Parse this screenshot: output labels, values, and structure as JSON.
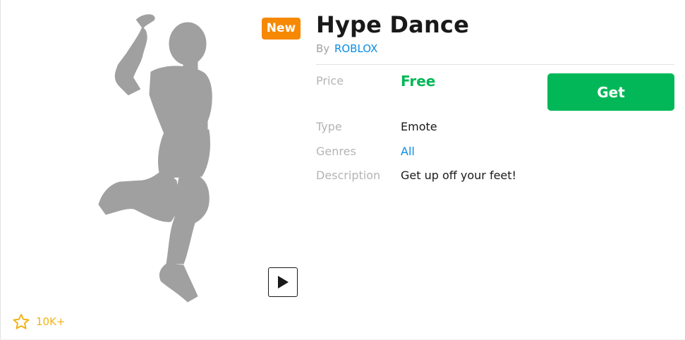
{
  "item": {
    "badge": "New",
    "title": "Hype Dance",
    "by_prefix": "By",
    "creator": "ROBLOX"
  },
  "details": {
    "price_label": "Price",
    "price_value": "Free",
    "type_label": "Type",
    "type_value": "Emote",
    "genres_label": "Genres",
    "genres_value": "All",
    "description_label": "Description",
    "description_value": "Get up off your feet!"
  },
  "actions": {
    "get_label": "Get",
    "play_icon": "play-icon"
  },
  "favorites": {
    "icon": "star-outline-icon",
    "count": "10K+"
  },
  "colors": {
    "badge_orange": "#f68802",
    "buy_green": "#02b757",
    "link_blue": "#0b8de3",
    "favorite_gold": "#f2b318",
    "silhouette_gray": "#a0a0a0"
  }
}
